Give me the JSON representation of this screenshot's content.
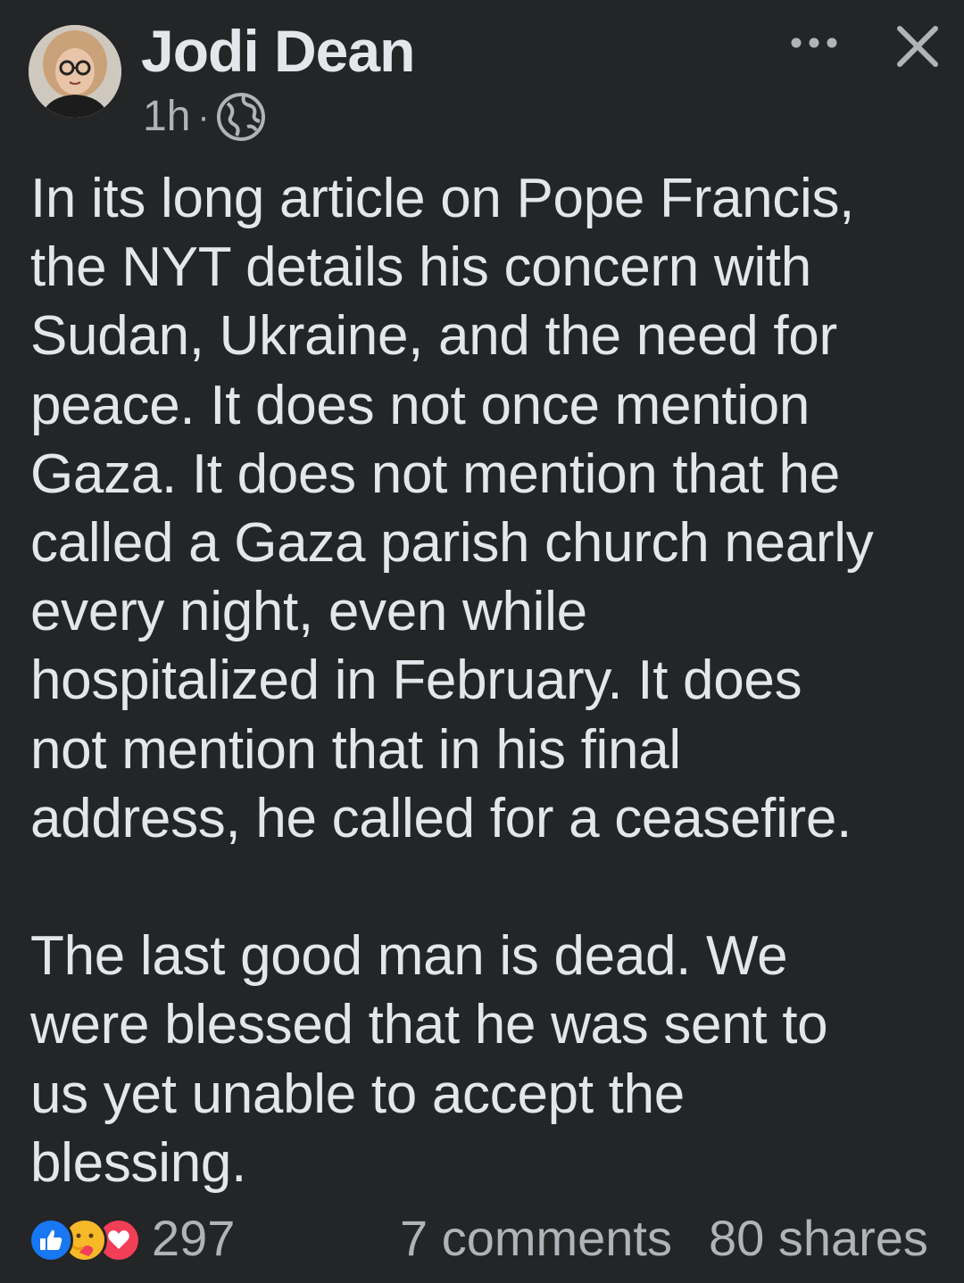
{
  "post": {
    "author": "Jodi Dean",
    "timestamp": "1h",
    "separator": "·",
    "privacy_icon": "globe-icon",
    "body_lines_p1": [
      "In its long article on Pope Francis,",
      "the NYT details his concern with",
      "Sudan, Ukraine, and the need for",
      "peace. It does not once mention",
      "Gaza. It does not mention that he",
      "called a Gaza parish church nearly",
      "every night, even while",
      "hospitalized in February. It does",
      "not mention that in his final",
      "address, he called for a ceasefire."
    ],
    "body_lines_p2": [
      "The last good man is dead. We",
      "were blessed that he was sent to",
      "us yet unable to accept the",
      "blessing."
    ]
  },
  "header": {
    "more_icon": "more-options-icon",
    "close_icon": "close-icon"
  },
  "footer": {
    "reaction_icons": [
      "like-icon",
      "care-icon",
      "love-icon"
    ],
    "reaction_count": "297",
    "comments": "7 comments",
    "shares": "80 shares"
  },
  "colors": {
    "background": "#242526",
    "primary_text": "#e4e6eb",
    "secondary_text": "#b0b3b8",
    "like_blue": "#1877f2",
    "love_red": "#f33e58",
    "care_yellow": "#f7b928"
  }
}
